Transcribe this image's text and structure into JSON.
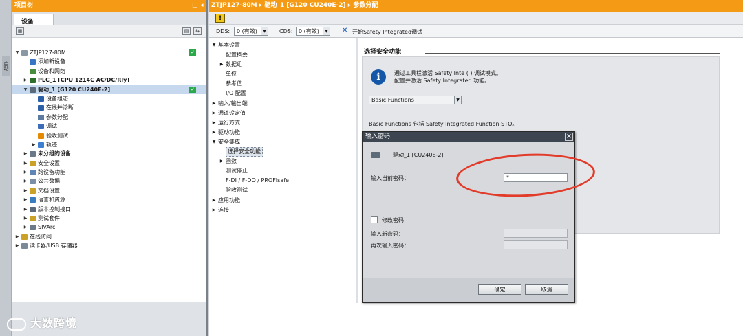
{
  "project_tree": {
    "title": "项目树",
    "tab": "设备",
    "nodes": [
      {
        "label": "ZTJP127-80M",
        "level": 0,
        "expand": "▼",
        "bold": false,
        "check": true,
        "icon": "#8a97a5"
      },
      {
        "label": "添加新设备",
        "level": 1,
        "expand": "",
        "bold": false,
        "check": false,
        "icon": "#3a74c4"
      },
      {
        "label": "设备和网络",
        "level": 1,
        "expand": "",
        "bold": false,
        "check": false,
        "icon": "#4a8c3f"
      },
      {
        "label": "PLC_1 [CPU 1214C AC/DC/Rly]",
        "level": 1,
        "expand": "▶",
        "bold": true,
        "check": false,
        "icon": "#2d6e2d"
      },
      {
        "label": "驱动_1 [G120 CU240E-2]",
        "level": 1,
        "expand": "▼",
        "bold": true,
        "check": true,
        "icon": "#5a6a7a",
        "selected": true
      },
      {
        "label": "设备组态",
        "level": 2,
        "expand": "",
        "bold": false,
        "check": false,
        "icon": "#2d5fa8"
      },
      {
        "label": "在线并诊断",
        "level": 2,
        "expand": "",
        "bold": false,
        "check": false,
        "icon": "#2d5fa8"
      },
      {
        "label": "参数分配",
        "level": 2,
        "expand": "",
        "bold": false,
        "check": false,
        "icon": "#5d7ba0"
      },
      {
        "label": "调试",
        "level": 2,
        "expand": "",
        "bold": false,
        "check": false,
        "icon": "#3b6cb7"
      },
      {
        "label": "验收测试",
        "level": 2,
        "expand": "",
        "bold": false,
        "check": false,
        "icon": "#e58a00"
      },
      {
        "label": "轨迹",
        "level": 2,
        "expand": "▶",
        "bold": false,
        "check": false,
        "icon": "#3c7fd0"
      },
      {
        "label": "未分组的设备",
        "level": 1,
        "expand": "▶",
        "bold": true,
        "check": false,
        "icon": "#6b7a8a"
      },
      {
        "label": "安全设置",
        "level": 1,
        "expand": "▶",
        "bold": false,
        "check": false,
        "icon": "#c9a227"
      },
      {
        "label": "跨设备功能",
        "level": 1,
        "expand": "▶",
        "bold": false,
        "check": false,
        "icon": "#5f86b5"
      },
      {
        "label": "公共数据",
        "level": 1,
        "expand": "▶",
        "bold": false,
        "check": false,
        "icon": "#7a8fa6"
      },
      {
        "label": "文档设置",
        "level": 1,
        "expand": "▶",
        "bold": false,
        "check": false,
        "icon": "#c9a227"
      },
      {
        "label": "语言和资源",
        "level": 1,
        "expand": "▶",
        "bold": false,
        "check": false,
        "icon": "#3a7cc0"
      },
      {
        "label": "版本控制接口",
        "level": 1,
        "expand": "▶",
        "bold": false,
        "check": false,
        "icon": "#5a6a7a"
      },
      {
        "label": "测试套件",
        "level": 1,
        "expand": "▶",
        "bold": false,
        "check": false,
        "icon": "#c9a227"
      },
      {
        "label": "SIVArc",
        "level": 1,
        "expand": "▶",
        "bold": false,
        "check": false,
        "icon": "#6b7a8a"
      },
      {
        "label": "在线访问",
        "level": 0,
        "expand": "▶",
        "bold": false,
        "check": false,
        "icon": "#c9a227"
      },
      {
        "label": "读卡器/USB 存储器",
        "level": 0,
        "expand": "▶",
        "bold": false,
        "check": false,
        "icon": "#7a8a99"
      }
    ]
  },
  "breadcrumb": "ZTJP127-80M ▸ 驱动_1 [G120 CU240E-2] ▸ 参数分配",
  "toolbar": {
    "dds_label": "DDS:",
    "dds_value": "0 (有效)",
    "cds_label": "CDS:",
    "cds_value": "0 (有效)",
    "safety_label": "开始Safety  Integrated调试"
  },
  "nav_items": [
    {
      "label": "基本设置",
      "level": 0,
      "expand": "▼"
    },
    {
      "label": "配置摘要",
      "level": 1,
      "expand": ""
    },
    {
      "label": "数据组",
      "level": 1,
      "expand": "▶"
    },
    {
      "label": "单位",
      "level": 1,
      "expand": ""
    },
    {
      "label": "参考值",
      "level": 1,
      "expand": ""
    },
    {
      "label": "I/O 配置",
      "level": 1,
      "expand": ""
    },
    {
      "label": "输入/输出端",
      "level": 0,
      "expand": "▶"
    },
    {
      "label": "通道设定值",
      "level": 0,
      "expand": "▶"
    },
    {
      "label": "运行方式",
      "level": 0,
      "expand": "▶"
    },
    {
      "label": "驱动功能",
      "level": 0,
      "expand": "▶"
    },
    {
      "label": "安全集成",
      "level": 0,
      "expand": "▼"
    },
    {
      "label": "选择安全功能",
      "level": 1,
      "expand": "",
      "selected": true
    },
    {
      "label": "函数",
      "level": 1,
      "expand": "▶"
    },
    {
      "label": "测试停止",
      "level": 1,
      "expand": ""
    },
    {
      "label": "F-DI / F-DO / PROFIsafe",
      "level": 1,
      "expand": ""
    },
    {
      "label": "验收测试",
      "level": 1,
      "expand": ""
    },
    {
      "label": "应用功能",
      "level": 0,
      "expand": "▶"
    },
    {
      "label": "连接",
      "level": 0,
      "expand": "▶"
    }
  ],
  "content": {
    "section_title": "选择安全功能",
    "info_line1": "通过工具栏激活 Safety Inte (  ) 调试模式。",
    "info_line2": "配置并激活 Safety Integrated 功能。",
    "function_select": "Basic Functions",
    "function_desc": "Basic Functions 包括 Safety Integrated Function STO。"
  },
  "dialog": {
    "title": "输入密码",
    "drive_label": "驱动_1 [CU240E-2]",
    "current_password_label": "输入当前密码：",
    "current_password_value": "*",
    "change_password_label": "修改密码",
    "new_password_label": "输入新密码：",
    "repeat_password_label": "再次输入密码：",
    "ok_label": "确定",
    "cancel_label": "取消"
  },
  "watermark": "大数跨境",
  "colors": {
    "accent_orange": "#f49a15",
    "highlight_red": "#e23b2a",
    "info_blue": "#1457a8",
    "check_green": "#2aa84a"
  }
}
